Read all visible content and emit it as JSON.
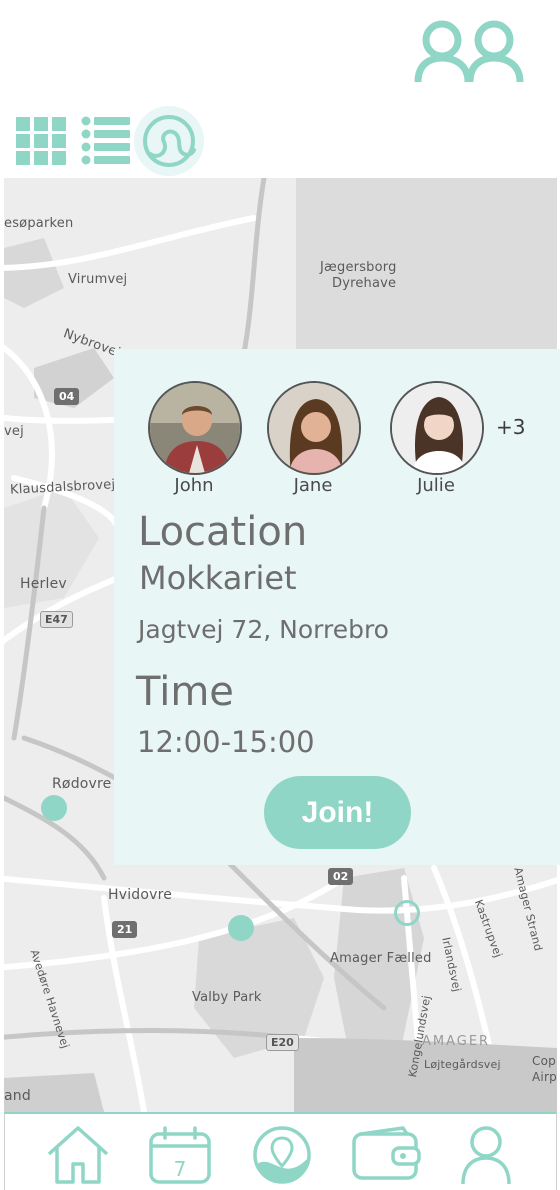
{
  "header": {
    "friends_icon": "two-people-icon"
  },
  "view_toggles": {
    "grid_icon": "grid-icon",
    "list_icon": "list-icon",
    "map_icon": "map-swirl-icon",
    "active": "map",
    "accent": "#8fd6c6"
  },
  "map": {
    "labels": {
      "esoparken": "esøparken",
      "virumvej": "Virumvej",
      "nybrovej": "Nybrovej",
      "jaegersborg": "Jægersborg",
      "dyrehave": "Dyrehave",
      "vej": "vej",
      "klausdalsbrovej": "Klausdalsbrovej",
      "herlev": "Herlev",
      "rodovre": "Rødovre",
      "hvidovre": "Hvidovre",
      "avedore": "Avedøre Havnevej",
      "valby_park": "Valby Park",
      "amager_faelled": "Amager Fælled",
      "kongelundsvej": "Kongelundsvej",
      "irlandsvej": "Irlandsvej",
      "kastrupvej": "Kastrupvej",
      "amager_strand": "Amager Strand",
      "amager": "AMAGER",
      "lojtegardsvej": "Løjtegårdsvej",
      "cop": "Cop",
      "airp": "Airp",
      "and": "and"
    },
    "roads": {
      "r04": "04",
      "e47": "E47",
      "r02": "02",
      "r21": "21",
      "e20": "E20"
    }
  },
  "event": {
    "attendees": [
      {
        "name": "John"
      },
      {
        "name": "Jane"
      },
      {
        "name": "Julie"
      }
    ],
    "more_count": "+3",
    "location_title": "Location",
    "location_name": "Mokkariet",
    "address": "Jagtvej 72, Norrebro",
    "time_title": "Time",
    "time_value": "12:00-15:00",
    "join_label": "Join!"
  },
  "bottom_nav": {
    "items": [
      {
        "icon": "home-icon"
      },
      {
        "icon": "calendar-icon",
        "label": "7"
      },
      {
        "icon": "map-pin-icon"
      },
      {
        "icon": "wallet-icon"
      },
      {
        "icon": "profile-icon"
      }
    ]
  }
}
